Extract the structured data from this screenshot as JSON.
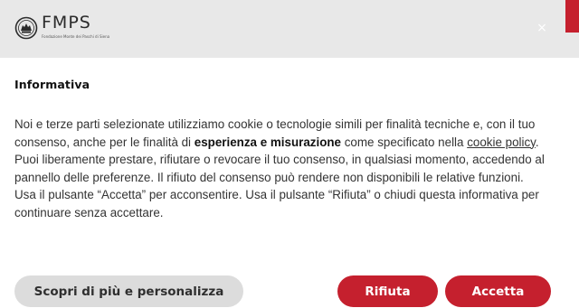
{
  "header": {
    "logo_text": "FMPS",
    "logo_subtitle": "Fondazione Monte dei Paschi di Siena",
    "close_symbol": "×",
    "brand_color": "#c5202e"
  },
  "banner": {
    "title": "Informativa",
    "p1_before": "Noi e terze parti selezionate utilizziamo cookie o tecnologie simili per finalità tecniche e, con il tuo consenso, anche per le finalità di ",
    "p1_bold": "esperienza e misurazione",
    "p1_middle": " come specificato nella ",
    "p1_link": "cookie policy",
    "p1_after": ".",
    "p2": "Puoi liberamente prestare, rifiutare o revocare il tuo consenso, in qualsiasi momento, accedendo al pannello delle preferenze. Il rifiuto del consenso può rendere non disponibili le relative funzioni.",
    "p3": "Usa il pulsante “Accetta” per acconsentire. Usa il pulsante “Rifiuta” o chiudi questa informativa per continuare senza accettare."
  },
  "buttons": {
    "customize": "Scopri di più e personalizza",
    "reject": "Rifiuta",
    "accept": "Accetta"
  },
  "icons": {
    "logo_emblem": "fmps-emblem-icon",
    "close": "close-icon"
  }
}
